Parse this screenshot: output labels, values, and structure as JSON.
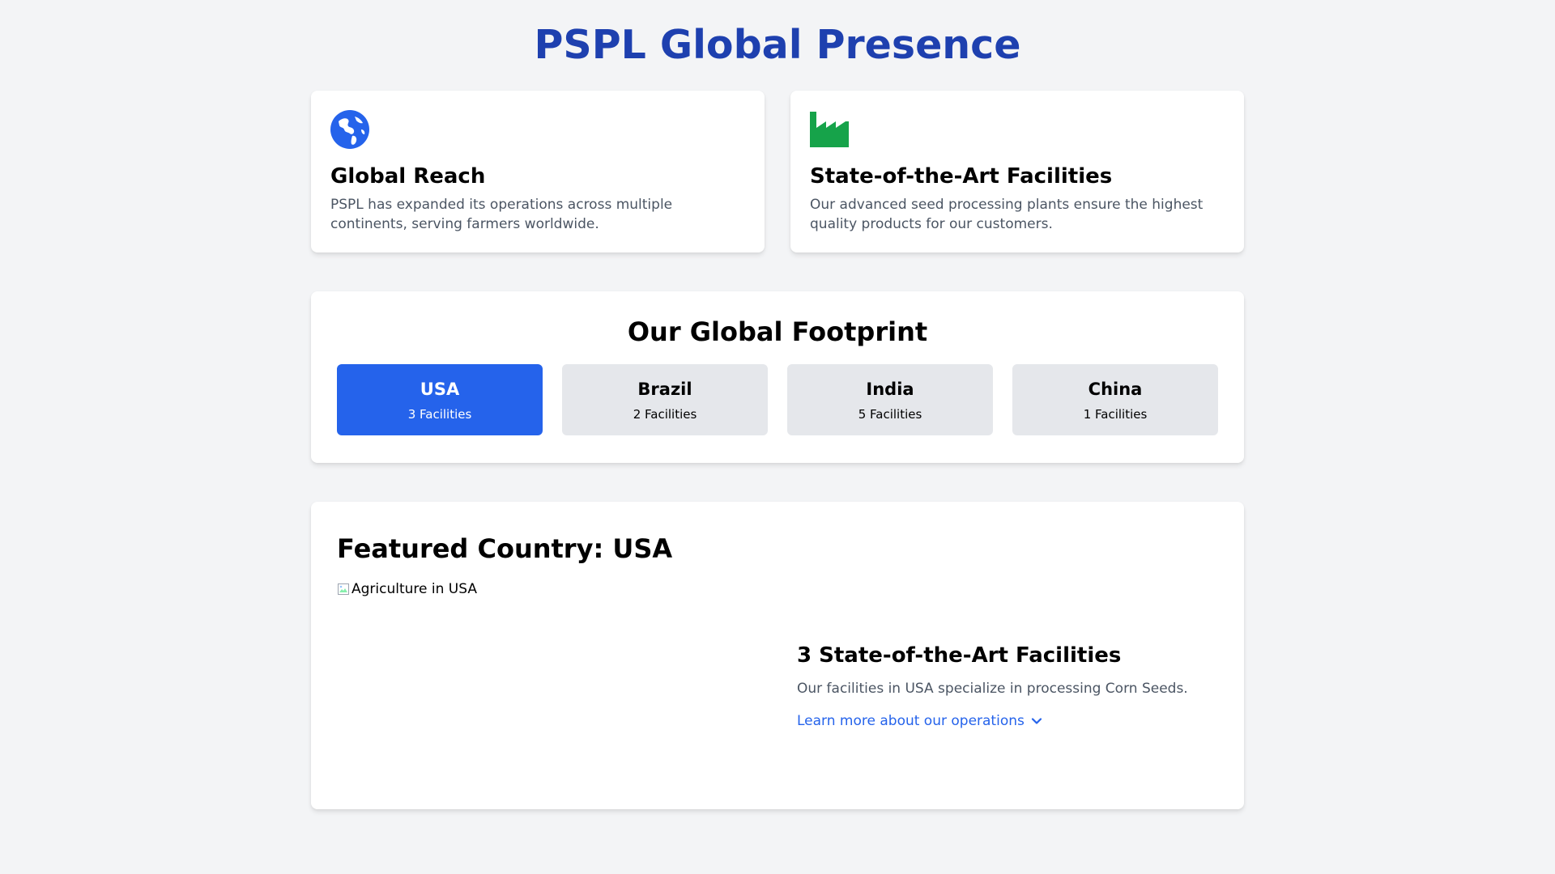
{
  "page": {
    "title": "PSPL Global Presence"
  },
  "colors": {
    "title": "#1e40af",
    "accent": "#2563eb",
    "factory": "#16a34a",
    "inactive_card": "#e5e7eb",
    "muted_text": "#4b5563"
  },
  "info_cards": [
    {
      "icon": "globe-icon",
      "heading": "Global Reach",
      "text": "PSPL has expanded its operations across multiple continents, serving farmers worldwide."
    },
    {
      "icon": "factory-icon",
      "heading": "State-of-the-Art Facilities",
      "text": "Our advanced seed processing plants ensure the highest quality products for our customers."
    }
  ],
  "footprint": {
    "title": "Our Global Footprint",
    "countries": [
      {
        "name": "USA",
        "facilities": "3 Facilities",
        "active": true
      },
      {
        "name": "Brazil",
        "facilities": "2 Facilities",
        "active": false
      },
      {
        "name": "India",
        "facilities": "5 Facilities",
        "active": false
      },
      {
        "name": "China",
        "facilities": "1 Facilities",
        "active": false
      }
    ]
  },
  "featured": {
    "title": "Featured Country: USA",
    "image_alt": "Agriculture in USA",
    "facilities_heading": "3 State-of-the-Art Facilities",
    "facilities_text": "Our facilities in USA specialize in processing Corn Seeds.",
    "learn_more": "Learn more about our operations"
  }
}
